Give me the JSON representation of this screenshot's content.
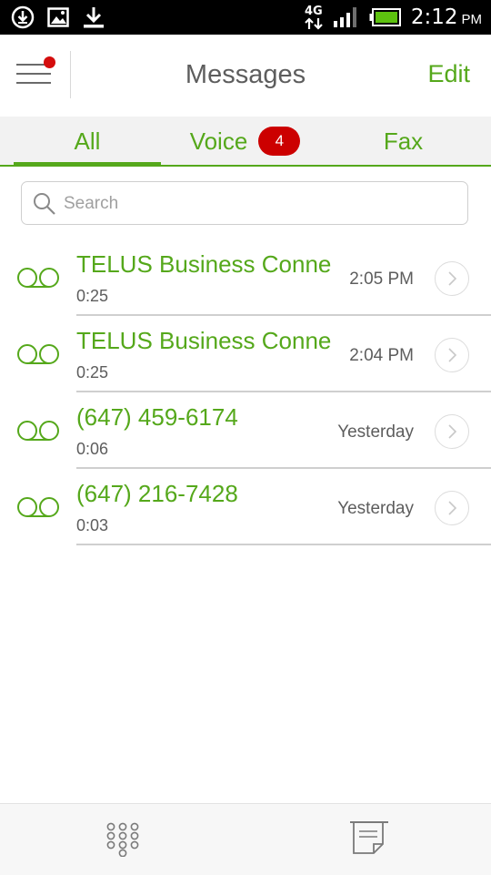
{
  "status_bar": {
    "network": "4G",
    "time": "2:12",
    "ampm": "PM",
    "icons": [
      "download-active-icon",
      "image-icon",
      "download-icon",
      "network-arrows-icon",
      "signal-icon",
      "battery-icon"
    ]
  },
  "header": {
    "title": "Messages",
    "edit_label": "Edit",
    "menu_icon": "hamburger-menu-icon"
  },
  "tabs": {
    "all": "All",
    "voice": "Voice",
    "voice_badge": "4",
    "fax": "Fax"
  },
  "search": {
    "placeholder": "Search"
  },
  "messages": [
    {
      "name": "TELUS Business Connect",
      "duration": "0:25",
      "time": "2:05 PM"
    },
    {
      "name": "TELUS Business Connect",
      "duration": "0:25",
      "time": "2:04 PM"
    },
    {
      "name": "(647) 459-6174",
      "duration": "0:06",
      "time": "Yesterday"
    },
    {
      "name": "(647) 216-7428",
      "duration": "0:03",
      "time": "Yesterday"
    }
  ],
  "colors": {
    "accent": "#55a81b",
    "badge": "#cc0000",
    "text_gray": "#5d5d5d"
  },
  "bottom_bar": {
    "icons": [
      "dialpad-icon",
      "notes-icon"
    ]
  }
}
